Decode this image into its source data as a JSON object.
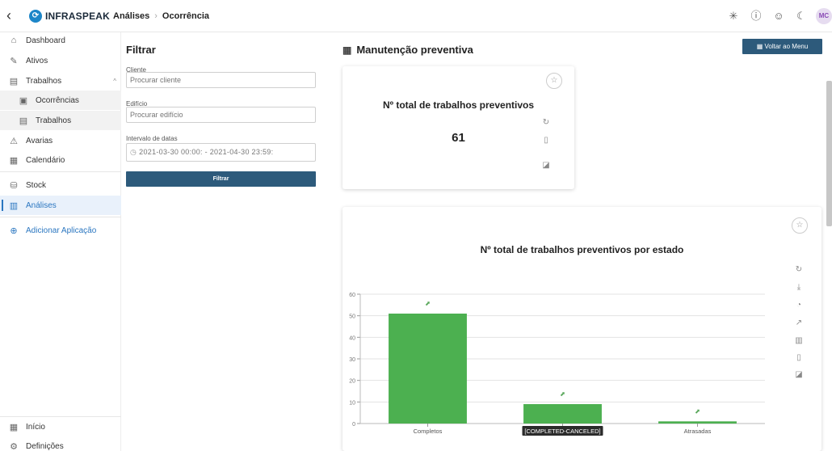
{
  "topbar": {
    "back_icon": "chevron-left-icon",
    "logo_text": "INFRASPEAK",
    "logo_icon": "infraspeak-logo-icon",
    "breadcrumb": [
      "Análises",
      "Ocorrência"
    ],
    "icons": [
      "asterisk-icon",
      "info-icon",
      "smiley-icon",
      "moon-icon"
    ],
    "avatar_initials": "MC"
  },
  "sidebar": {
    "items": [
      {
        "label": "Dashboard",
        "icon": "home-icon"
      },
      {
        "label": "Ativos",
        "icon": "wrench-icon"
      },
      {
        "label": "Trabalhos",
        "icon": "clipboard-icon",
        "expanded": true
      },
      {
        "label": "Ocorrências",
        "icon": "clipboard-check-icon",
        "sub": true
      },
      {
        "label": "Trabalhos",
        "icon": "clipboard-icon",
        "sub": true
      },
      {
        "label": "Avarias",
        "icon": "warning-icon"
      },
      {
        "label": "Calendário",
        "icon": "calendar-icon"
      },
      {
        "label": "Stock",
        "icon": "box-icon"
      },
      {
        "label": "Análises",
        "icon": "bar-chart-icon",
        "active": true
      },
      {
        "label": "Adicionar Aplicação",
        "icon": "plus-circle-icon"
      }
    ],
    "bottom": [
      {
        "label": "Início",
        "icon": "grid-icon"
      },
      {
        "label": "Definições",
        "icon": "settings-icon"
      }
    ]
  },
  "filter": {
    "title": "Filtrar",
    "client_label": "Cliente",
    "client_placeholder": "Procurar cliente",
    "building_label": "Edifício",
    "building_placeholder": "Procurar edifício",
    "date_label": "Intervalo de datas",
    "date_value": "2021-03-30 00:00: - 2021-04-30 23:59:",
    "button": "Filtrar"
  },
  "main": {
    "title": "Manutenção preventiva",
    "back_button": "Voltar ao Menu",
    "kpi_card": {
      "title": "Nº total de trabalhos preventivos",
      "value": "61",
      "tools": [
        "refresh-icon",
        "document-icon",
        "pdf-icon"
      ]
    },
    "chart_card": {
      "tools": [
        "refresh-icon",
        "download-icon",
        "pie-chart-icon",
        "line-chart-icon",
        "bar-chart-icon",
        "document-icon",
        "pdf-icon"
      ]
    }
  },
  "colors": {
    "accent": "#2a76c0",
    "button": "#2d5a7b",
    "bar": "#4cb050"
  },
  "chart_data": {
    "type": "bar",
    "title": "Nº total de trabalhos preventivos por estado",
    "categories": [
      "Completos",
      "[COMPLETED-CANCELED]",
      "Atrasadas"
    ],
    "values": [
      51,
      9,
      1
    ],
    "ylim": [
      0,
      60
    ],
    "yticks": [
      0,
      10,
      20,
      30,
      40,
      50,
      60
    ],
    "grid": true,
    "legend": "none"
  }
}
